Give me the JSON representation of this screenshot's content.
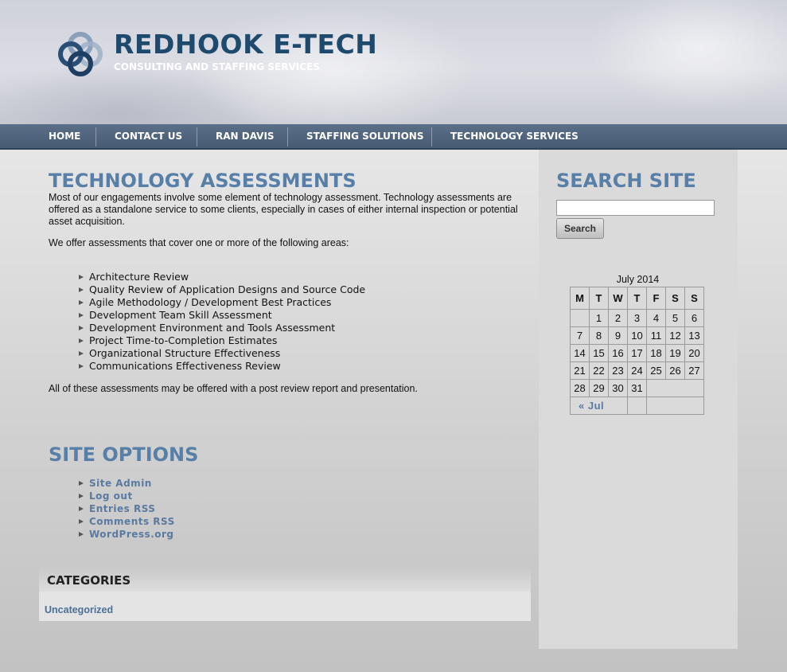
{
  "header": {
    "title": "REDHOOK E-TECH",
    "tagline": "CONSULTING AND STAFFING SERVICES",
    "logo_icon": "interlocking-rings-logo"
  },
  "nav": {
    "items": [
      {
        "label": "HOME"
      },
      {
        "label": "CONTACT US"
      },
      {
        "label": "RAN DAVIS"
      },
      {
        "label": "STAFFING SOLUTIONS"
      },
      {
        "label": "TECHNOLOGY SERVICES"
      }
    ]
  },
  "main": {
    "title": "TECHNOLOGY ASSESSMENTS",
    "intro": "Most of our engagements involve some element of technology assessment. Technology assessments are offered as a standalone service to some clients, especially in cases of either internal inspection or potential asset acquisition.",
    "lead": "We offer assessments that cover one or more of the following areas:",
    "areas": [
      "Architecture Review",
      "Quality Review of Application Designs and Source Code",
      "Agile Methodology / Development Best Practices",
      "Development Team Skill Assessment",
      "Development Environment and Tools Assessment",
      "Project Time-to-Completion Estimates",
      "Organizational Structure Effectiveness",
      "Communications Effectiveness Review"
    ],
    "closing": "All of these assessments may be offered with a post review report and presentation."
  },
  "options": {
    "title": "SITE OPTIONS",
    "links": [
      "Site Admin",
      "Log out",
      "Entries RSS",
      "Comments RSS",
      "WordPress.org"
    ]
  },
  "categories": {
    "heading": "CATEGORIES",
    "items": [
      "Uncategorized"
    ]
  },
  "sidebar": {
    "search_title": "SEARCH SITE",
    "search_value": "",
    "search_button": "Search",
    "calendar": {
      "caption": "July 2014",
      "weekdays": [
        "M",
        "T",
        "W",
        "T",
        "F",
        "S",
        "S"
      ],
      "weeks": [
        [
          "",
          "1",
          "2",
          "3",
          "4",
          "5",
          "6"
        ],
        [
          "7",
          "8",
          "9",
          "10",
          "11",
          "12",
          "13"
        ],
        [
          "14",
          "15",
          "16",
          "17",
          "18",
          "19",
          "20"
        ],
        [
          "21",
          "22",
          "23",
          "24",
          "25",
          "26",
          "27"
        ],
        [
          "28",
          "29",
          "30",
          "31",
          "",
          "",
          ""
        ]
      ],
      "prev_link": "« Jul"
    }
  },
  "colors": {
    "brand": "#1e4a6e",
    "heading": "#587fa8",
    "nav_bg": "#4f637c",
    "link": "#5a7aa0"
  }
}
